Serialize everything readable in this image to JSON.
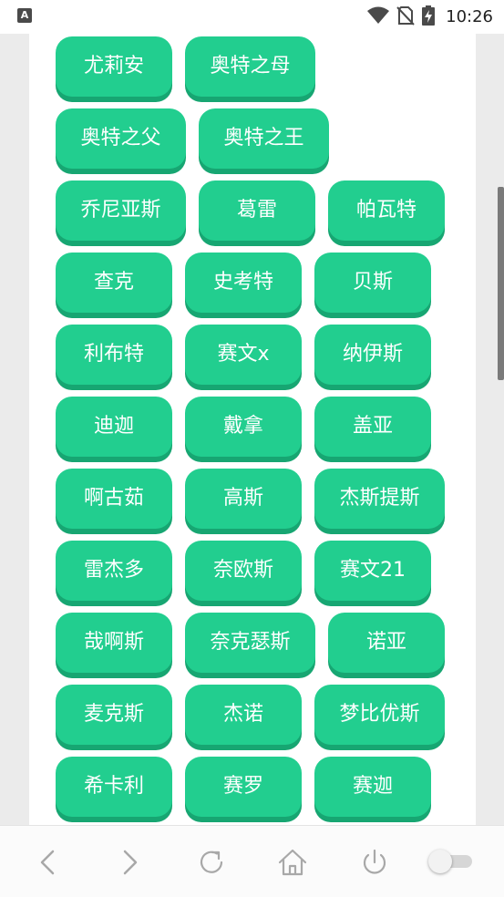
{
  "status_bar": {
    "time": "10:26",
    "icons": [
      "app-notification-icon",
      "wifi-icon",
      "no-sim-icon",
      "battery-charging-icon"
    ]
  },
  "tags": [
    "尤莉安",
    "奥特之母",
    "奥特之父",
    "奥特之王",
    "乔尼亚斯",
    "葛雷",
    "帕瓦特",
    "查克",
    "史考特",
    "贝斯",
    "利布特",
    "赛文x",
    "纳伊斯",
    "迪迦",
    "戴拿",
    "盖亚",
    "啊古茹",
    "高斯",
    "杰斯提斯",
    "雷杰多",
    "奈欧斯",
    "赛文21",
    "哉啊斯",
    "奈克瑟斯",
    "诺亚",
    "麦克斯",
    "杰诺",
    "梦比优斯",
    "希卡利",
    "赛罗",
    "赛迦"
  ],
  "nav_bar": {
    "buttons": [
      "back-icon",
      "forward-icon",
      "refresh-icon",
      "home-icon",
      "power-icon"
    ],
    "toggle_on": false
  },
  "colors": {
    "tag_bg": "#22ce8f",
    "tag_shadow": "#17a672",
    "tag_text": "#ffffff"
  }
}
